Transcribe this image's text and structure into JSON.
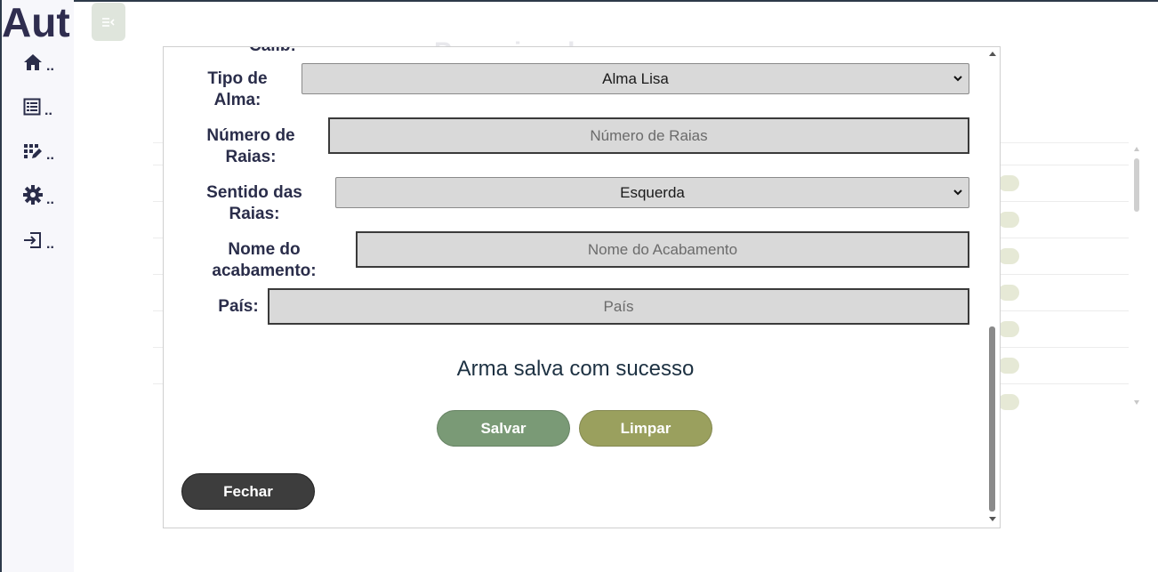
{
  "app": {
    "title_visible": "Aut"
  },
  "sidebar": {
    "items": [
      {
        "icon": "home-icon",
        "label": ".."
      },
      {
        "icon": "list-icon",
        "label": ".."
      },
      {
        "icon": "edit-grid-icon",
        "label": ".."
      },
      {
        "icon": "gear-icon",
        "label": ".."
      },
      {
        "icon": "logout-icon",
        "label": ".."
      }
    ]
  },
  "background": {
    "page_title_partial": "Pesquisa de armas"
  },
  "modal": {
    "cut_label": "Calib:",
    "fields": {
      "tipo_alma": {
        "label_line1": "Tipo de",
        "label_line2": "Alma:",
        "value": "Alma Lisa"
      },
      "numero_raias": {
        "label_line1": "Número de",
        "label_line2": "Raias:",
        "placeholder": "Número de Raias"
      },
      "sentido_raias": {
        "label_line1": "Sentido das",
        "label_line2": "Raias:",
        "value": "Esquerda"
      },
      "nome_acabamento": {
        "label_line1": "Nome do",
        "label_line2": "acabamento:",
        "placeholder": "Nome do Acabamento"
      },
      "pais": {
        "label": "País:",
        "placeholder": "País"
      }
    },
    "status_message": "Arma salva com sucesso",
    "buttons": {
      "save": "Salvar",
      "clear": "Limpar",
      "close": "Fechar"
    }
  },
  "colors": {
    "save": "#7a9a76",
    "clear": "#9aa05e",
    "close": "#3d3d3d",
    "field_bg": "#d9d9d9",
    "text": "#2a2d4a"
  }
}
